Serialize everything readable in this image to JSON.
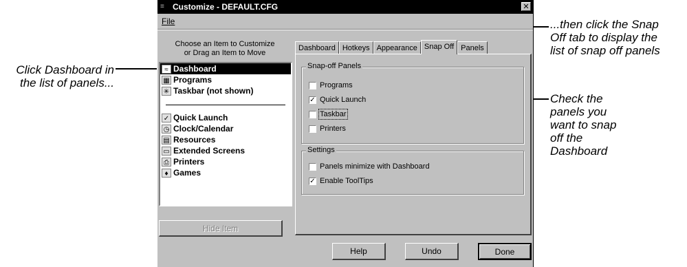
{
  "annotations": {
    "left": "Click Dashboard in\n the list of panels...",
    "top_right": "...then click the Snap\nOff tab to display the\nlist of snap off panels",
    "right": "Check the\npanels you\nwant to snap\noff the\nDashboard"
  },
  "window": {
    "title": "Customize - DEFAULT.CFG",
    "close": "✕"
  },
  "menu": {
    "file": "File"
  },
  "left": {
    "heading": "Choose an Item to Customize\nor Drag an Item to Move",
    "items": [
      {
        "label": "Dashboard",
        "icon": "dashboard-icon",
        "glyph": "≈"
      },
      {
        "label": "Programs",
        "icon": "programs-icon",
        "glyph": "▦"
      },
      {
        "label": "Taskbar (not shown)",
        "icon": "taskbar-icon",
        "glyph": "✳"
      }
    ],
    "items2": [
      {
        "label": "Quick Launch",
        "icon": "quick-launch-icon",
        "glyph": "✓"
      },
      {
        "label": "Clock/Calendar",
        "icon": "clock-icon",
        "glyph": "◷"
      },
      {
        "label": "Resources",
        "icon": "resources-icon",
        "glyph": "▤"
      },
      {
        "label": "Extended Screens",
        "icon": "extended-screens-icon",
        "glyph": "▭"
      },
      {
        "label": "Printers",
        "icon": "printers-icon",
        "glyph": "⎙"
      },
      {
        "label": "Games",
        "icon": "games-icon",
        "glyph": "♦"
      }
    ],
    "hide_button": "Hide Item"
  },
  "tabs": [
    "Dashboard",
    "Hotkeys",
    "Appearance",
    "Snap Off",
    "Panels"
  ],
  "active_tab": "Snap Off",
  "snapoff": {
    "legend": "Snap-off Panels",
    "options": [
      {
        "label": "Programs",
        "checked": false
      },
      {
        "label": "Quick Launch",
        "checked": true
      },
      {
        "label": "Taskbar",
        "checked": false
      },
      {
        "label": "Printers",
        "checked": false
      }
    ]
  },
  "settings": {
    "legend": "Settings",
    "options": [
      {
        "label": "Panels minimize with Dashboard",
        "checked": false
      },
      {
        "label": "Enable ToolTips",
        "checked": true
      }
    ]
  },
  "buttons": {
    "help": "Help",
    "undo": "Undo",
    "done": "Done"
  },
  "check_mark": "✓"
}
